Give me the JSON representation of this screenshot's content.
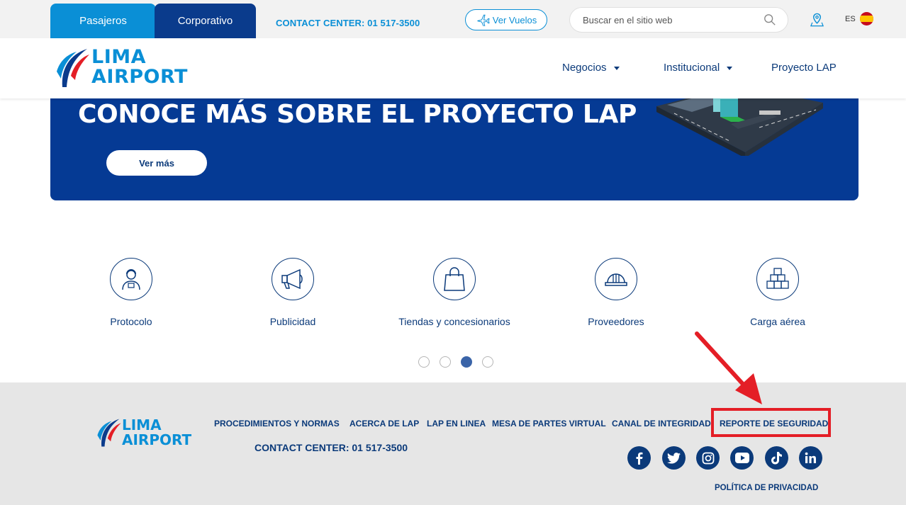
{
  "topbar": {
    "tabs": [
      "Pasajeros",
      "Corporativo"
    ],
    "contact": "CONTACT CENTER: 01 517-3500",
    "vuelos_label": "Ver Vuelos",
    "search_placeholder": "Buscar en el sitio web",
    "language": "ES"
  },
  "header": {
    "logo_line1": "LIMA",
    "logo_line2": "AIRPORT",
    "nav": [
      "Negocios",
      "Institucional",
      "Proyecto LAP"
    ]
  },
  "banner": {
    "title": "CONOCE MÁS SOBRE EL PROYECTO LAP",
    "button": "Ver más"
  },
  "services": [
    {
      "label": "Protocolo",
      "icon": "agent-icon"
    },
    {
      "label": "Publicidad",
      "icon": "megaphone-icon"
    },
    {
      "label": "Tiendas y concesionarios",
      "icon": "shopping-bag-icon"
    },
    {
      "label": "Proveedores",
      "icon": "hard-hat-icon"
    },
    {
      "label": "Carga aérea",
      "icon": "boxes-icon"
    }
  ],
  "carousel": {
    "count": 4,
    "active": 3
  },
  "footer": {
    "logo_line1": "LIMA",
    "logo_line2": "AIRPORT",
    "links": [
      "PROCEDIMIENTOS Y NORMAS",
      "ACERCA DE LAP",
      "LAP EN LINEA",
      "MESA DE PARTES VIRTUAL",
      "CANAL DE INTEGRIDAD",
      "REPORTE DE SEGURIDAD"
    ],
    "contact": "CONTACT CENTER: 01 517-3500",
    "social": [
      "facebook-icon",
      "twitter-icon",
      "instagram-icon",
      "youtube-icon",
      "tiktok-icon",
      "linkedin-icon"
    ],
    "privacy": "POLÍTICA DE PRIVACIDAD"
  },
  "colors": {
    "brand_blue": "#0a8fd6",
    "navy": "#0b3a7a",
    "banner": "#053a94",
    "annotation_red": "#e41e26"
  }
}
